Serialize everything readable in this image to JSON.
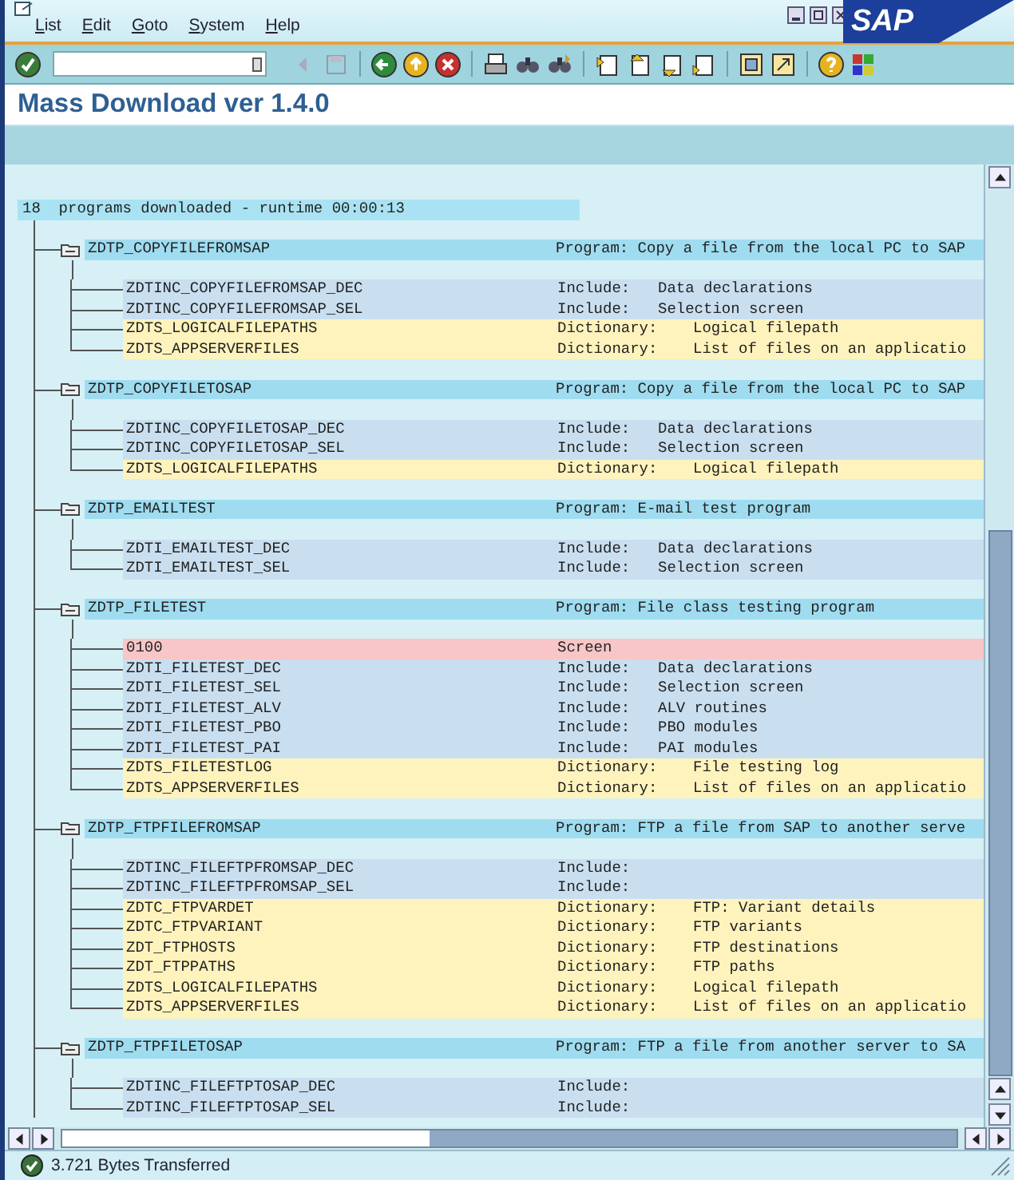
{
  "window": {
    "logo": "SAP"
  },
  "menu": [
    {
      "label": "List"
    },
    {
      "label": "Edit"
    },
    {
      "label": "Goto"
    },
    {
      "label": "System"
    },
    {
      "label": "Help"
    }
  ],
  "title": "Mass Download ver 1.4.0",
  "list": {
    "summary": "18  programs downloaded - runtime 00:00:13",
    "programs": [
      {
        "name": "ZDTP_COPYFILEFROMSAP",
        "description": "Program: Copy a file from the local PC to SAP",
        "children": [
          {
            "kind": "include",
            "name": "ZDTINC_COPYFILEFROMSAP_DEC",
            "type": "Include:",
            "description": "Data declarations"
          },
          {
            "kind": "include",
            "name": "ZDTINC_COPYFILEFROMSAP_SEL",
            "type": "Include:",
            "description": "Selection screen"
          },
          {
            "kind": "dictionary",
            "name": "ZDTS_LOGICALFILEPATHS",
            "type": "Dictionary:",
            "description": "Logical filepath"
          },
          {
            "kind": "dictionary",
            "name": "ZDTS_APPSERVERFILES",
            "type": "Dictionary:",
            "description": "List of files on an applicatio"
          }
        ]
      },
      {
        "name": "ZDTP_COPYFILETOSAP",
        "description": "Program: Copy a file from the local PC to SAP",
        "children": [
          {
            "kind": "include",
            "name": "ZDTINC_COPYFILETOSAP_DEC",
            "type": "Include:",
            "description": "Data declarations"
          },
          {
            "kind": "include",
            "name": "ZDTINC_COPYFILETOSAP_SEL",
            "type": "Include:",
            "description": "Selection screen"
          },
          {
            "kind": "dictionary",
            "name": "ZDTS_LOGICALFILEPATHS",
            "type": "Dictionary:",
            "description": "Logical filepath"
          }
        ]
      },
      {
        "name": "ZDTP_EMAILTEST",
        "description": "Program: E-mail test program",
        "children": [
          {
            "kind": "include",
            "name": "ZDTI_EMAILTEST_DEC",
            "type": "Include:",
            "description": "Data declarations"
          },
          {
            "kind": "include",
            "name": "ZDTI_EMAILTEST_SEL",
            "type": "Include:",
            "description": "Selection screen"
          }
        ]
      },
      {
        "name": "ZDTP_FILETEST",
        "description": "Program: File class testing program",
        "children": [
          {
            "kind": "screen",
            "name": "0100",
            "type": "Screen"
          },
          {
            "kind": "include",
            "name": "ZDTI_FILETEST_DEC",
            "type": "Include:",
            "description": "Data declarations"
          },
          {
            "kind": "include",
            "name": "ZDTI_FILETEST_SEL",
            "type": "Include:",
            "description": "Selection screen"
          },
          {
            "kind": "include",
            "name": "ZDTI_FILETEST_ALV",
            "type": "Include:",
            "description": "ALV routines"
          },
          {
            "kind": "include",
            "name": "ZDTI_FILETEST_PBO",
            "type": "Include:",
            "description": "PBO modules"
          },
          {
            "kind": "include",
            "name": "ZDTI_FILETEST_PAI",
            "type": "Include:",
            "description": "PAI modules"
          },
          {
            "kind": "dictionary",
            "name": "ZDTS_FILETESTLOG",
            "type": "Dictionary:",
            "description": "File testing log"
          },
          {
            "kind": "dictionary",
            "name": "ZDTS_APPSERVERFILES",
            "type": "Dictionary:",
            "description": "List of files on an applicatio"
          }
        ]
      },
      {
        "name": "ZDTP_FTPFILEFROMSAP",
        "description": "Program: FTP a file from SAP to another serve",
        "children": [
          {
            "kind": "include",
            "name": "ZDTINC_FILEFTPFROMSAP_DEC",
            "type": "Include:"
          },
          {
            "kind": "include",
            "name": "ZDTINC_FILEFTPFROMSAP_SEL",
            "type": "Include:"
          },
          {
            "kind": "dictionary",
            "name": "ZDTC_FTPVARDET",
            "type": "Dictionary:",
            "description": "FTP: Variant details"
          },
          {
            "kind": "dictionary",
            "name": "ZDTC_FTPVARIANT",
            "type": "Dictionary:",
            "description": "FTP variants"
          },
          {
            "kind": "dictionary",
            "name": "ZDT_FTPHOSTS",
            "type": "Dictionary:",
            "description": "FTP destinations"
          },
          {
            "kind": "dictionary",
            "name": "ZDT_FTPPATHS",
            "type": "Dictionary:",
            "description": "FTP paths"
          },
          {
            "kind": "dictionary",
            "name": "ZDTS_LOGICALFILEPATHS",
            "type": "Dictionary:",
            "description": "Logical filepath"
          },
          {
            "kind": "dictionary",
            "name": "ZDTS_APPSERVERFILES",
            "type": "Dictionary:",
            "description": "List of files on an applicatio"
          }
        ]
      },
      {
        "name": "ZDTP_FTPFILETOSAP",
        "description": "Program: FTP a file from another server to SA",
        "children": [
          {
            "kind": "include",
            "name": "ZDTINC_FILEFTPTOSAP_DEC",
            "type": "Include:"
          },
          {
            "kind": "include",
            "name": "ZDTINC_FILEFTPTOSAP_SEL",
            "type": "Include:"
          }
        ]
      }
    ]
  },
  "status_bar": {
    "message": "3.721 Bytes Transferred"
  }
}
